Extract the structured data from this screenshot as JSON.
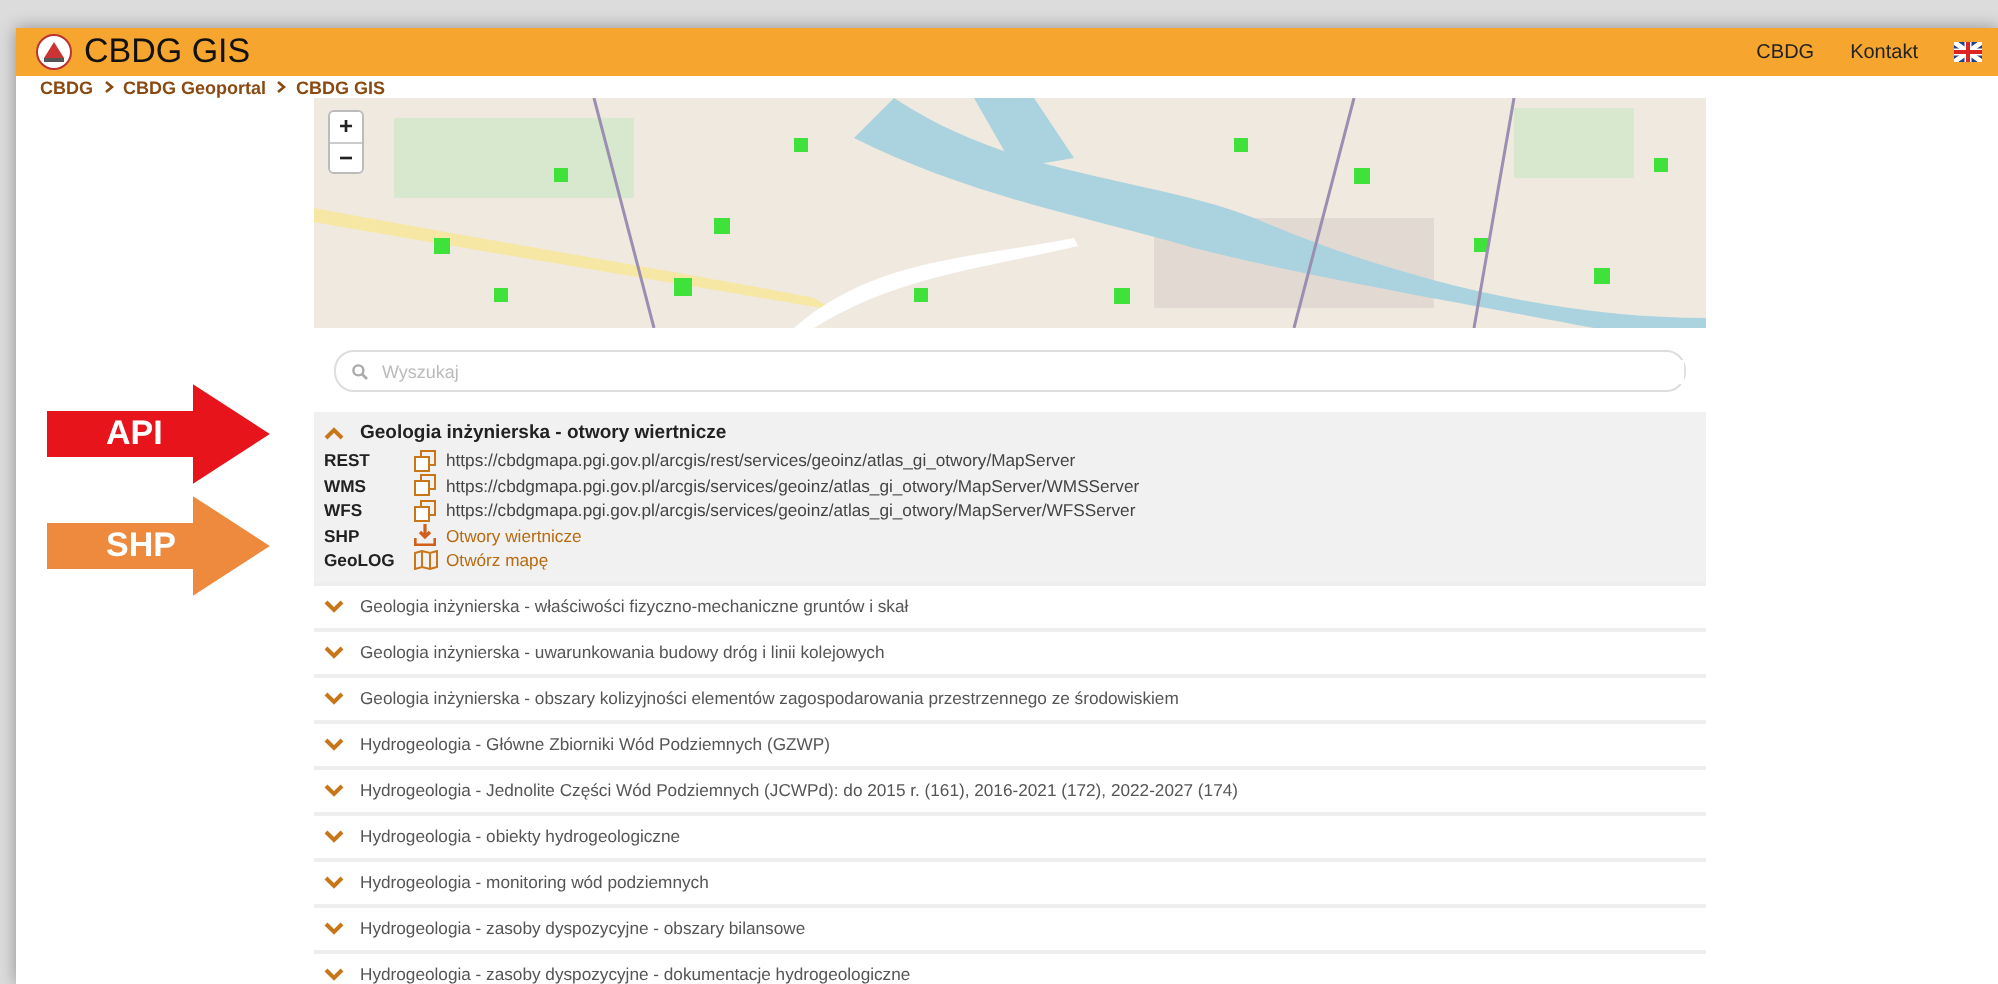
{
  "header": {
    "title": "CBDG GIS",
    "links": [
      "CBDG",
      "Kontakt"
    ]
  },
  "breadcrumb": [
    "CBDG",
    "CBDG Geoportal",
    "CBDG GIS"
  ],
  "map": {
    "kind": "picture",
    "zoom_in": "+",
    "zoom_out": "−"
  },
  "search": {
    "placeholder": "Wyszukaj"
  },
  "callouts": [
    {
      "label": "API",
      "color": "#e8141c"
    },
    {
      "label": "SHP",
      "color": "#ee8a3e"
    }
  ],
  "layers": [
    {
      "title": "Geologia inżynierska - otwory wiertnicze",
      "expanded": true,
      "services": [
        {
          "type": "REST",
          "kind": "url",
          "value": "https://cbdgmapa.pgi.gov.pl/arcgis/rest/services/geoinz/atlas_gi_otwory/MapServer"
        },
        {
          "type": "WMS",
          "kind": "url",
          "value": "https://cbdgmapa.pgi.gov.pl/arcgis/services/geoinz/atlas_gi_otwory/MapServer/WMSServer"
        },
        {
          "type": "WFS",
          "kind": "url",
          "value": "https://cbdgmapa.pgi.gov.pl/arcgis/services/geoinz/atlas_gi_otwory/MapServer/WFSServer"
        },
        {
          "type": "SHP",
          "kind": "download",
          "value": "Otwory wiertnicze"
        },
        {
          "type": "GeoLOG",
          "kind": "map",
          "value": "Otwórz mapę"
        }
      ]
    },
    {
      "title": "Geologia inżynierska - właściwości fizyczno-mechaniczne gruntów i skał",
      "expanded": false
    },
    {
      "title": "Geologia inżynierska - uwarunkowania budowy dróg i linii kolejowych",
      "expanded": false
    },
    {
      "title": "Geologia inżynierska - obszary kolizyjności elementów zagospodarowania przestrzennego ze środowiskiem",
      "expanded": false
    },
    {
      "title": "Hydrogeologia - Główne Zbiorniki Wód Podziemnych (GZWP)",
      "expanded": false
    },
    {
      "title": "Hydrogeologia - Jednolite Części Wód Podziemnych (JCWPd): do 2015 r. (161), 2016-2021 (172), 2022-2027 (174)",
      "expanded": false
    },
    {
      "title": "Hydrogeologia - obiekty hydrogeologiczne",
      "expanded": false
    },
    {
      "title": "Hydrogeologia - monitoring wód podziemnych",
      "expanded": false
    },
    {
      "title": "Hydrogeologia - zasoby dyspozycyjne - obszary bilansowe",
      "expanded": false
    },
    {
      "title": "Hydrogeologia - zasoby dyspozycyjne - dokumentacje hydrogeologiczne",
      "expanded": false
    }
  ]
}
